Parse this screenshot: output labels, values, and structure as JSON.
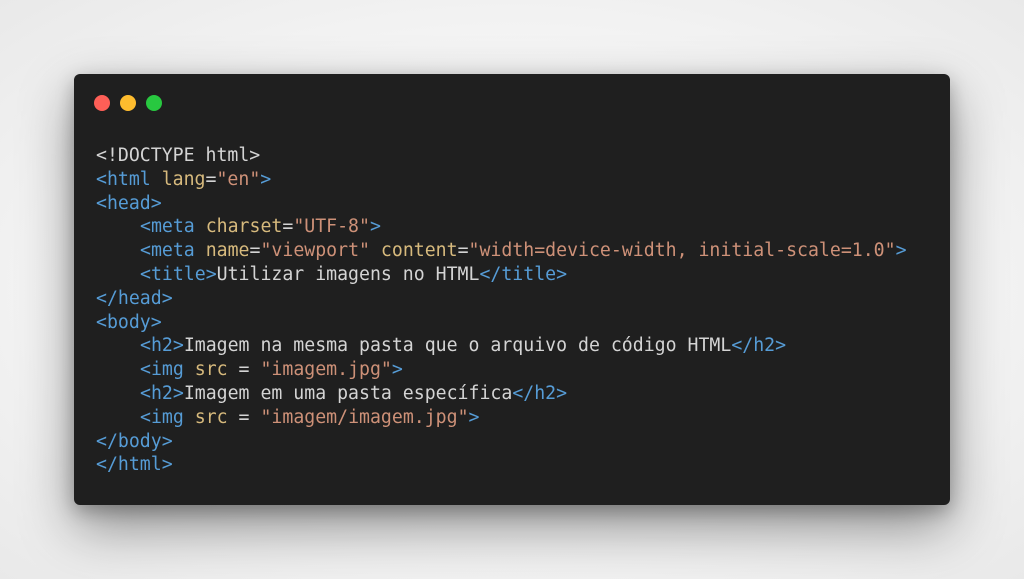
{
  "window": {
    "controls": {
      "close_color": "#fe5f57",
      "minimize_color": "#febc2e",
      "maximize_color": "#28c840"
    }
  },
  "code": {
    "lines": [
      {
        "indent": 0,
        "tokens": [
          {
            "t": "doctype",
            "v": "<!DOCTYPE html>"
          }
        ]
      },
      {
        "indent": 0,
        "tokens": [
          {
            "t": "tag",
            "v": "<html "
          },
          {
            "t": "attr",
            "v": "lang"
          },
          {
            "t": "txt",
            "v": "="
          },
          {
            "t": "str",
            "v": "\"en\""
          },
          {
            "t": "tag",
            "v": ">"
          }
        ]
      },
      {
        "indent": 0,
        "tokens": [
          {
            "t": "tag",
            "v": "<head>"
          }
        ]
      },
      {
        "indent": 1,
        "tokens": [
          {
            "t": "tag",
            "v": "<meta "
          },
          {
            "t": "attr",
            "v": "charset"
          },
          {
            "t": "txt",
            "v": "="
          },
          {
            "t": "str",
            "v": "\"UTF-8\""
          },
          {
            "t": "tag",
            "v": ">"
          }
        ]
      },
      {
        "indent": 1,
        "tokens": [
          {
            "t": "tag",
            "v": "<meta "
          },
          {
            "t": "attr",
            "v": "name"
          },
          {
            "t": "txt",
            "v": "="
          },
          {
            "t": "str",
            "v": "\"viewport\""
          },
          {
            "t": "txt",
            "v": " "
          },
          {
            "t": "attr",
            "v": "content"
          },
          {
            "t": "txt",
            "v": "="
          },
          {
            "t": "str",
            "v": "\"width=device-width, initial-scale=1.0\""
          },
          {
            "t": "tag",
            "v": ">"
          }
        ]
      },
      {
        "indent": 1,
        "tokens": [
          {
            "t": "tag",
            "v": "<title>"
          },
          {
            "t": "txt",
            "v": "Utilizar imagens no HTML"
          },
          {
            "t": "tag",
            "v": "</title>"
          }
        ]
      },
      {
        "indent": 0,
        "tokens": [
          {
            "t": "tag",
            "v": "</head>"
          }
        ]
      },
      {
        "indent": 0,
        "tokens": [
          {
            "t": "tag",
            "v": "<body>"
          }
        ]
      },
      {
        "indent": 1,
        "tokens": [
          {
            "t": "tag",
            "v": "<h2>"
          },
          {
            "t": "txt",
            "v": "Imagem na mesma pasta que o arquivo de código HTML"
          },
          {
            "t": "tag",
            "v": "</h2>"
          }
        ]
      },
      {
        "indent": 1,
        "tokens": [
          {
            "t": "tag",
            "v": "<img "
          },
          {
            "t": "attr",
            "v": "src"
          },
          {
            "t": "txt",
            "v": " = "
          },
          {
            "t": "str",
            "v": "\"imagem.jpg\""
          },
          {
            "t": "tag",
            "v": ">"
          }
        ]
      },
      {
        "indent": 1,
        "tokens": [
          {
            "t": "tag",
            "v": "<h2>"
          },
          {
            "t": "txt",
            "v": "Imagem em uma pasta específica"
          },
          {
            "t": "tag",
            "v": "</h2>"
          }
        ]
      },
      {
        "indent": 1,
        "tokens": [
          {
            "t": "tag",
            "v": "<img "
          },
          {
            "t": "attr",
            "v": "src"
          },
          {
            "t": "txt",
            "v": " = "
          },
          {
            "t": "str",
            "v": "\"imagem/imagem.jpg\""
          },
          {
            "t": "tag",
            "v": ">"
          }
        ]
      },
      {
        "indent": 0,
        "tokens": [
          {
            "t": "tag",
            "v": "</body>"
          }
        ]
      },
      {
        "indent": 0,
        "tokens": [
          {
            "t": "tag",
            "v": "</html>"
          }
        ]
      }
    ],
    "colors": {
      "background": "#1f1f1f",
      "tag": "#569cd6",
      "attribute": "#d7ba7d",
      "string": "#ce9178",
      "text": "#d4d4d4"
    }
  }
}
